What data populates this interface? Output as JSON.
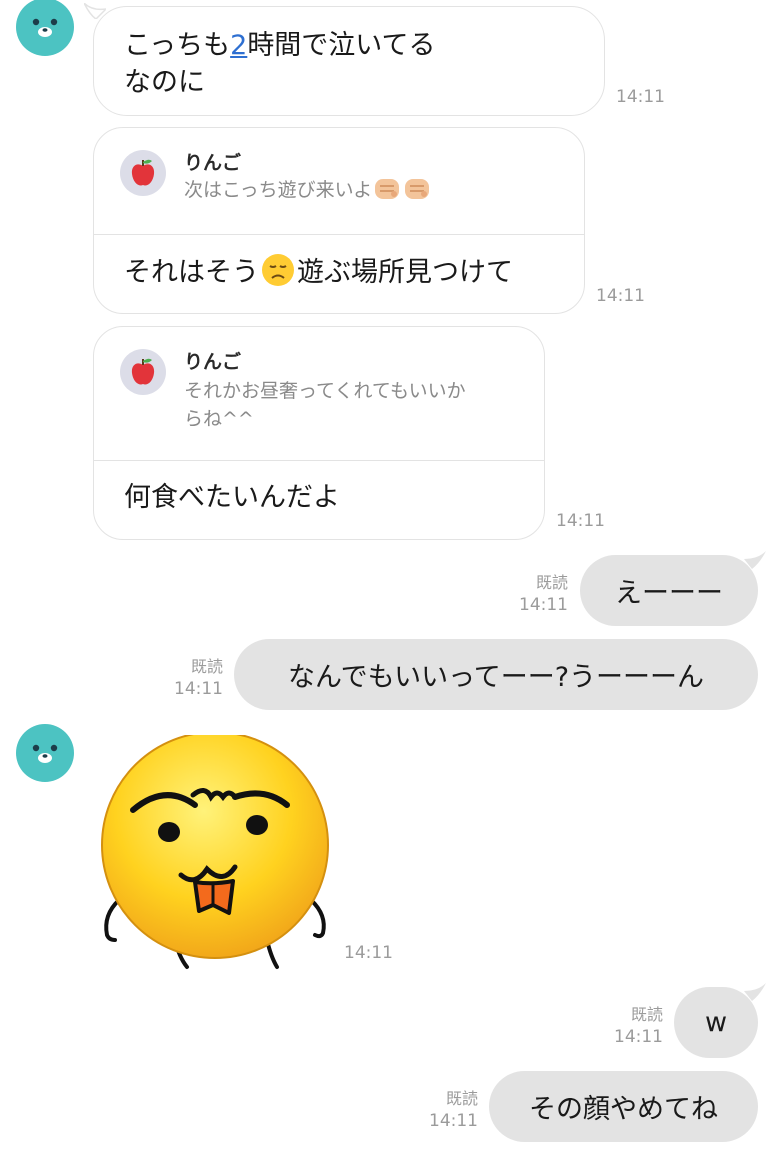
{
  "messages": {
    "m1": {
      "text_before": "こっちも",
      "link": "2",
      "text_after": "時間で泣いてる",
      "line2": "なのに",
      "time": "14:11"
    },
    "m2": {
      "reply_name": "りんご",
      "reply_quote": "次はこっち遊び来いよ",
      "text_a": "それはそう",
      "text_b": "遊ぶ場所見つけて",
      "time": "14:11"
    },
    "m3": {
      "reply_name": "りんご",
      "reply_quote_1": "それかお昼奢ってくれてもいいか",
      "reply_quote_2": "らね^^",
      "text": "何食べたいんだよ",
      "time": "14:11"
    },
    "m4": {
      "text": "えーーー",
      "read": "既読",
      "time": "14:11"
    },
    "m5": {
      "text": "なんでもいいってーー?うーーーん",
      "read": "既読",
      "time": "14:11"
    },
    "m6": {
      "sticker": "funny-face-sticker",
      "time": "14:11"
    },
    "m7": {
      "text": "w",
      "read": "既読",
      "time": "14:11"
    },
    "m8": {
      "text": "その顔やめてね",
      "read": "既読",
      "time": "14:11"
    }
  },
  "colors": {
    "avatar_bg": "#4cc3c2",
    "outgoing_bubble": "#e3e3e3",
    "incoming_border": "#e3e3e3",
    "link": "#2e6fd1",
    "timestamp": "#9b9b9b"
  },
  "icons": [
    "bear-avatar-icon",
    "apple-icon",
    "fist-emoji",
    "disappointed-face-emoji"
  ]
}
